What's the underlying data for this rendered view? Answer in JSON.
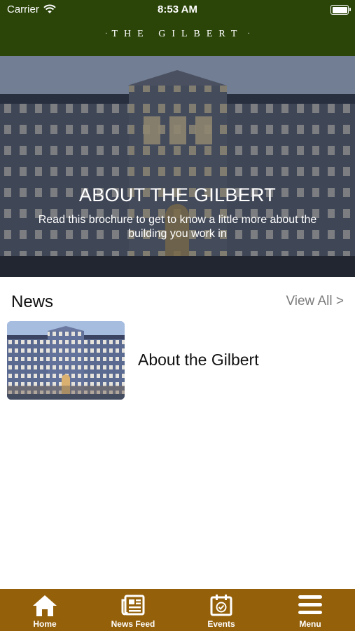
{
  "status_bar": {
    "carrier": "Carrier",
    "time": "8:53 AM"
  },
  "header": {
    "brand": "THE GILBERT"
  },
  "hero": {
    "title": "ABOUT THE GILBERT",
    "subtitle": "Read this brochure to get to know a little more about the building you work in"
  },
  "news": {
    "heading": "News",
    "view_all": "View All >",
    "items": [
      {
        "title": "About the Gilbert"
      }
    ]
  },
  "tabs": [
    {
      "label": "Home",
      "icon": "home-icon"
    },
    {
      "label": "News Feed",
      "icon": "newspaper-icon"
    },
    {
      "label": "Events",
      "icon": "calendar-check-icon"
    },
    {
      "label": "Menu",
      "icon": "hamburger-menu-icon"
    }
  ],
  "colors": {
    "header_bg": "#2b4509",
    "tabbar_bg": "#94600a",
    "view_all_text": "#7b7b7b"
  }
}
